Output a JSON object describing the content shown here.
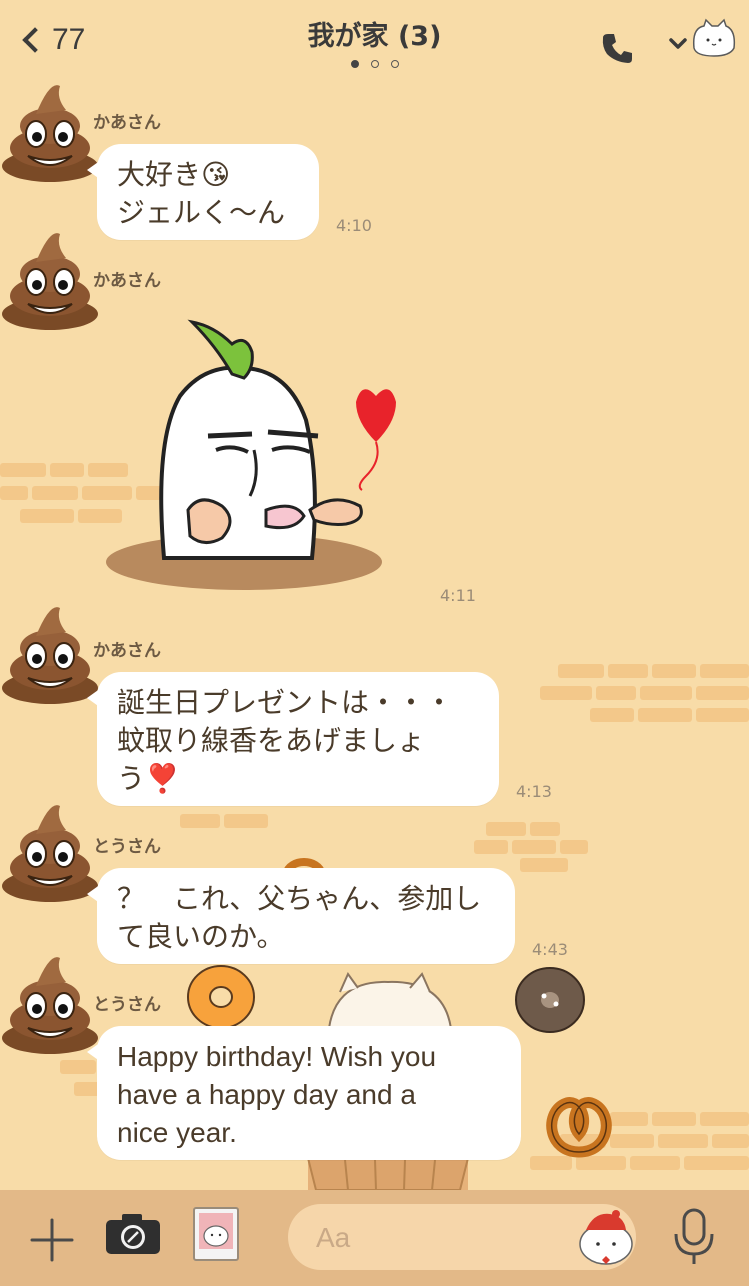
{
  "header": {
    "back_count": "77",
    "title": "我が家 (3)",
    "page_dots": 3,
    "active_dot": 0
  },
  "messages": [
    {
      "sender": "かあさん",
      "text_lines": [
        "大好き😘",
        "ジェルく〜ん"
      ],
      "time": "4:10",
      "avatar": "poop-emoji"
    },
    {
      "sender": "かあさん",
      "sticker": "daikon-kiss-sticker",
      "time": "4:11",
      "avatar": "poop-emoji"
    },
    {
      "sender": "かあさん",
      "text_lines": [
        "誕生日プレゼントは・・・",
        "蚊取り線香をあげましょ",
        "う❣️"
      ],
      "time": "4:13",
      "avatar": "poop-emoji"
    },
    {
      "sender": "とうさん",
      "text_lines": [
        "？　これ、父ちゃん、参加し",
        "て良いのか。"
      ],
      "time": "4:43",
      "avatar": "poop-emoji"
    },
    {
      "sender": "とうさん",
      "text_lines": [
        "Happy birthday! Wish you",
        "have a happy day and a",
        "nice year."
      ],
      "avatar": "poop-emoji"
    }
  ],
  "input_bar": {
    "placeholder": "Aa",
    "icons": [
      "plus-icon",
      "camera-icon",
      "photo-icon",
      "sticker-icon",
      "microphone-icon"
    ]
  },
  "colors": {
    "background": "#f8dca8",
    "bubble": "#ffffff",
    "input_bar": "#e3b988",
    "text": "#4a3b2a",
    "time": "#9b8c77"
  }
}
